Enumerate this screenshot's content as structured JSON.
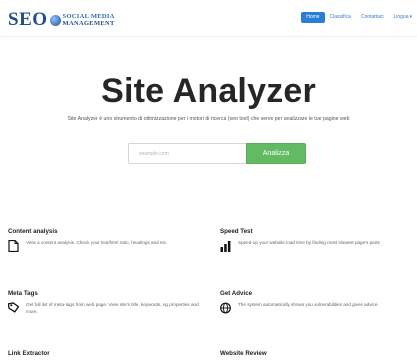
{
  "header": {
    "logo": {
      "main": "SEO",
      "line1": "SOCIAL MEDIA",
      "line2": "MANAGEMENT"
    },
    "nav": [
      {
        "label": "Home",
        "active": true
      },
      {
        "label": "Classifica"
      },
      {
        "label": "Contattaci"
      },
      {
        "label": "Lingua"
      }
    ]
  },
  "hero": {
    "title": "Site Analyzer",
    "subtitle": "Site Analyzer è uno strumento di ottimizzazione per i motori di ricerca (seo tool) che serve per analizzare le tue pagine web",
    "search_placeholder": "example.com",
    "button_label": "Analizza",
    "button_color": "#62bb62"
  },
  "features": [
    {
      "title": "Content analysis",
      "text": "View a content analysis. Check your text/html ratio, headings and etc.",
      "icon": "document-icon"
    },
    {
      "title": "Speed Test",
      "text": "Speed-up your website load time by finding most slowest page's parts",
      "icon": "bar-chart-icon"
    },
    {
      "title": "Meta Tags",
      "text": "Get full list of meta-tags from web page. View site's title, keywords, og properties and more.",
      "icon": "tag-icon"
    },
    {
      "title": "Get Advice",
      "text": "The system automatically shows you vulnerabilities and gives advice.",
      "icon": "globe-icon"
    },
    {
      "title": "Link Extractor",
      "text": "",
      "icon": "link-icon"
    },
    {
      "title": "Website Review",
      "text": "",
      "icon": "review-icon"
    }
  ],
  "colors": {
    "brand": "#1f4f8a",
    "nav_active": "#2a7fd4",
    "accent_green": "#62bb62"
  }
}
